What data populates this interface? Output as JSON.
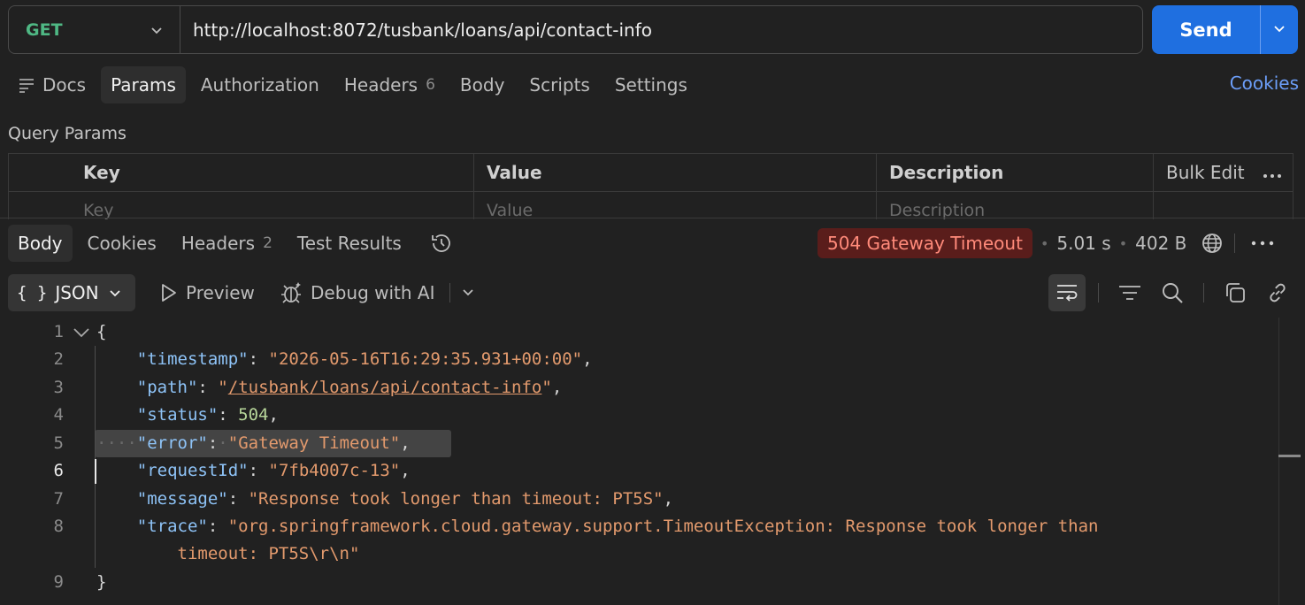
{
  "request": {
    "method": "GET",
    "url": "http://localhost:8072/tusbank/loans/api/contact-info",
    "send_label": "Send"
  },
  "request_tabs": [
    {
      "label": "Docs",
      "icon": "docs-icon"
    },
    {
      "label": "Params",
      "active": true
    },
    {
      "label": "Authorization"
    },
    {
      "label": "Headers",
      "count": "6"
    },
    {
      "label": "Body"
    },
    {
      "label": "Scripts"
    },
    {
      "label": "Settings"
    }
  ],
  "cookies_link": "Cookies",
  "query_params": {
    "title": "Query Params",
    "headers": {
      "key": "Key",
      "value": "Value",
      "description": "Description",
      "bulk_edit": "Bulk Edit"
    },
    "placeholders": {
      "key": "Key",
      "value": "Value",
      "description": "Description"
    }
  },
  "response_tabs": [
    {
      "label": "Body",
      "active": true
    },
    {
      "label": "Cookies"
    },
    {
      "label": "Headers",
      "count": "2"
    },
    {
      "label": "Test Results"
    }
  ],
  "response_status": {
    "status": "504 Gateway Timeout",
    "time": "5.01 s",
    "size": "402 B",
    "badge_bg": "#5a1d1b",
    "badge_fg": "#ff8a7a"
  },
  "response_toolbar": {
    "format": "JSON",
    "preview": "Preview",
    "debug": "Debug with AI"
  },
  "code_lines": [
    {
      "n": "1",
      "text": "{"
    },
    {
      "n": "2",
      "key": "\"timestamp\"",
      "value": "\"2026-05-16T16:29:35.931+00:00\"",
      "tail": ","
    },
    {
      "n": "3",
      "key": "\"path\"",
      "value_q1": "\"",
      "value_link": "/tusbank/loans/api/contact-info",
      "value_q2": "\"",
      "tail": ","
    },
    {
      "n": "4",
      "key": "\"status\"",
      "number": "504",
      "tail": ","
    },
    {
      "n": "5",
      "key": "\"error\"",
      "value": "\"Gateway Timeout\"",
      "tail": ","
    },
    {
      "n": "6",
      "key": "\"requestId\"",
      "value": "\"7fb4007c-13\"",
      "tail": ","
    },
    {
      "n": "7",
      "key": "\"message\"",
      "value": "\"Response took longer than timeout: PT5S\"",
      "tail": ","
    },
    {
      "n": "8",
      "key": "\"trace\"",
      "value": "\"org.springframework.cloud.gateway.support.TimeoutException: Response took longer than",
      "cont": "timeout: PT5S\\r\\n\""
    },
    {
      "n": "9",
      "text": "}"
    }
  ],
  "colors": {
    "accent": "#1f6fe0",
    "method": "#4fb884",
    "link": "#6c9ef8",
    "json_key": "#8ec3f7",
    "json_string": "#e39a6d",
    "json_number": "#b7d69a"
  }
}
